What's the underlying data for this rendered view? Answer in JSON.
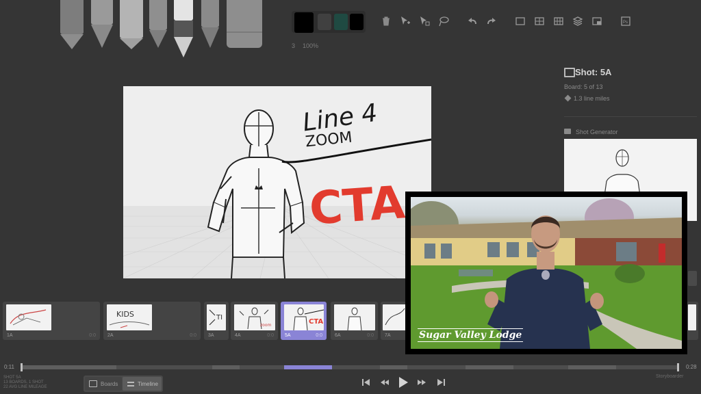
{
  "toolbar": {
    "brush_size": "3",
    "opacity": "100%"
  },
  "swatches": [
    "#000000",
    "#404040",
    "#1f4a42",
    "#000000"
  ],
  "inspector": {
    "title": "Shot: 5A",
    "board_info": "Board: 5 of 13",
    "line_miles": "1.3 line miles",
    "shot_generator_label": "Shot Generator"
  },
  "canvas": {
    "text_line": "Line 4",
    "text_zoom": "ZOOM",
    "text_cta": "CTA"
  },
  "thumbnails": [
    {
      "label": "1A",
      "dur": "0:0"
    },
    {
      "label": "2A",
      "dur": "0:0"
    },
    {
      "label": "3A",
      "dur": "0:0"
    },
    {
      "label": "4A",
      "dur": "0:0"
    },
    {
      "label": "5A",
      "dur": "0:0"
    },
    {
      "label": "6A",
      "dur": "0:0"
    },
    {
      "label": "7A",
      "dur": ""
    }
  ],
  "timeline": {
    "start_time": "0:11",
    "end_time": "0:28"
  },
  "footer": {
    "info_line1": "SHOT 5A",
    "info_line2": "13 BOARDS, 1 SHOT",
    "info_line3": "22 AVG LINE MILEAGE",
    "boards_tab": "Boards",
    "timeline_tab": "Timeline",
    "brand": "Storyboarder"
  },
  "video": {
    "caption": "Sugar Valley Lodge"
  }
}
